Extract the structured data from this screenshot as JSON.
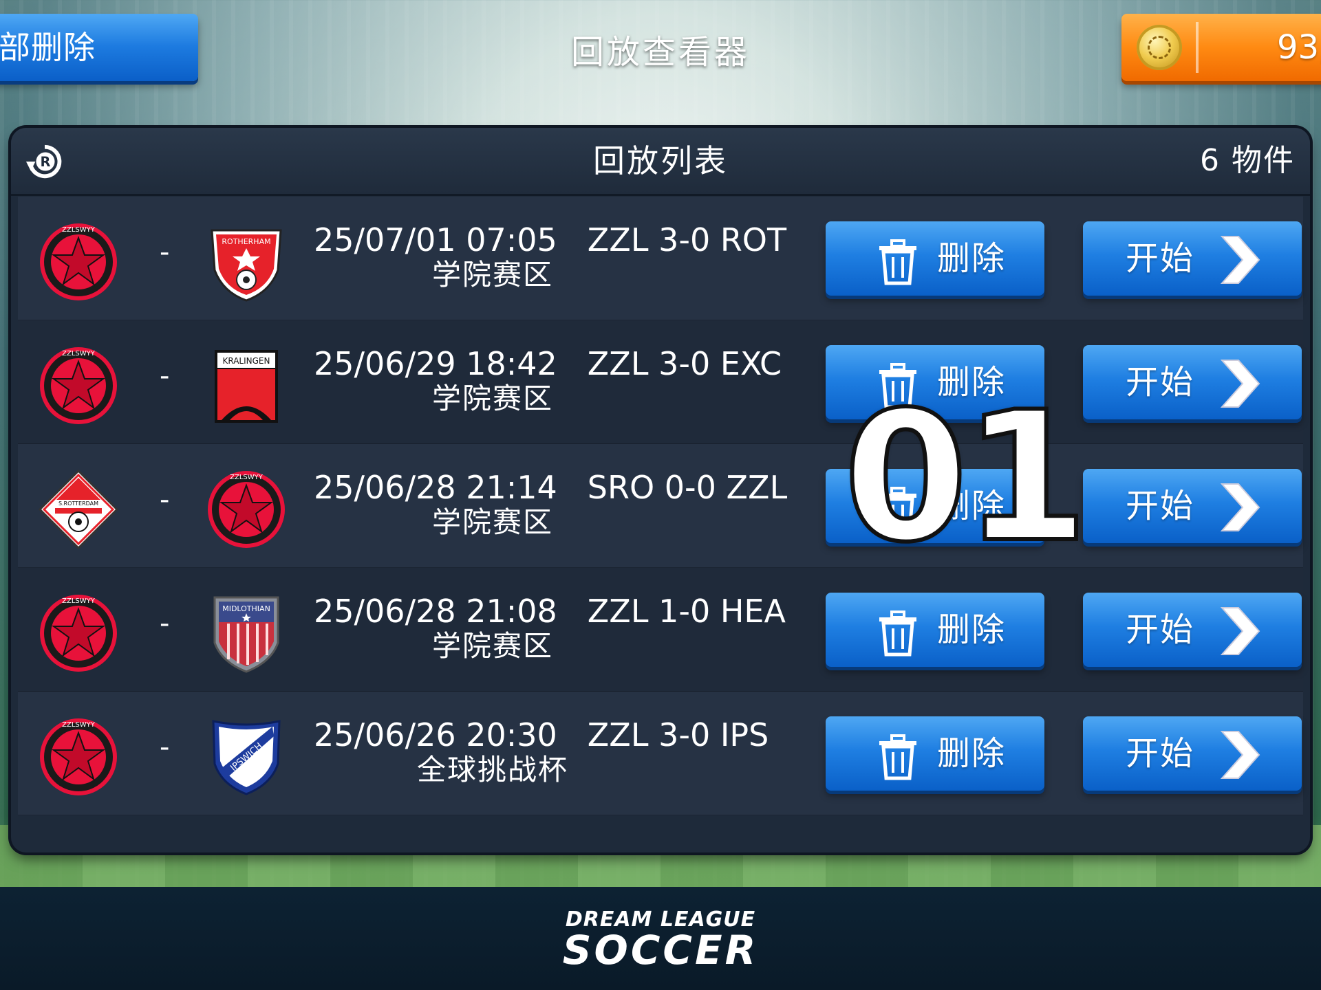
{
  "top_bar": {
    "delete_all_label": "部删除",
    "title": "回放查看器",
    "currency_value": "93,"
  },
  "panel": {
    "title": "回放列表",
    "count": "6 物件"
  },
  "rows": [
    {
      "home_badge": "zzlswyy-star-badge",
      "away_badge": "rotherham-badge",
      "date": "25/07/01 07:05",
      "result": "ZZL 3-0 ROT",
      "competition": "学院赛区",
      "delete_label": "删除",
      "start_label": "开始"
    },
    {
      "home_badge": "zzlswyy-star-badge",
      "away_badge": "kralingen-badge",
      "date": "25/06/29 18:42",
      "result": "ZZL 3-0 EXC",
      "competition": "学院赛区",
      "delete_label": "删除",
      "start_label": "开始"
    },
    {
      "home_badge": "s-rotterdam-badge",
      "away_badge": "zzlswyy-star-badge",
      "date": "25/06/28 21:14",
      "result": "SRO 0-0 ZZL",
      "competition": "学院赛区",
      "delete_label": "删除",
      "start_label": "开始"
    },
    {
      "home_badge": "zzlswyy-star-badge",
      "away_badge": "midlothian-badge",
      "date": "25/06/28 21:08",
      "result": "ZZL 1-0 HEA",
      "competition": "学院赛区",
      "delete_label": "删除",
      "start_label": "开始"
    },
    {
      "home_badge": "zzlswyy-star-badge",
      "away_badge": "ipswich-badge",
      "date": "25/06/26 20:30",
      "result": "ZZL 3-0 IPS",
      "competition": "全球挑战杯",
      "delete_label": "删除",
      "start_label": "开始"
    }
  ],
  "badge_text": {
    "zzlswyy": "ZZLSWYY",
    "rotherham": "ROTHERHAM",
    "kralingen": "KRALINGEN",
    "s_rotterdam": "S.ROTTERDAM",
    "midlothian": "MIDLOTHIAN",
    "ipswich": "IPSWICH"
  },
  "overlay": {
    "number": "01"
  },
  "footer": {
    "logo_top": "DREAM LEAGUE",
    "logo_bottom": "SOCCER"
  },
  "colors": {
    "button_blue": "#1f7fe2",
    "currency_orange": "#ff8a12",
    "panel_bg": "#1e2a3a",
    "badge_red": "#e8123a"
  },
  "icons": {
    "replay": "replay-icon",
    "coin": "coin-icon",
    "delete": "trash-icon",
    "start": "chevron-right-icon"
  }
}
